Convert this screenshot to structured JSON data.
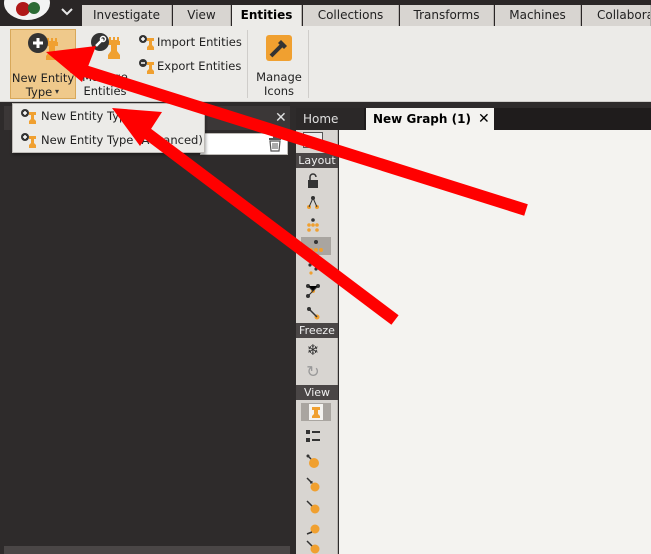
{
  "menubar": {
    "tabs": [
      {
        "label": "Investigate"
      },
      {
        "label": "View"
      },
      {
        "label": "Entities"
      },
      {
        "label": "Collections"
      },
      {
        "label": "Transforms"
      },
      {
        "label": "Machines"
      },
      {
        "label": "Collabora"
      }
    ],
    "active_tab": "Entities"
  },
  "ribbon": {
    "new_entity_type": {
      "line1": "New Entity",
      "line2": "Type"
    },
    "manage_entities": {
      "line1": "Manage",
      "line2": "Entities"
    },
    "import_entities": "Import Entities",
    "export_entities": "Export Entities",
    "manage_icons": {
      "line1": "Manage",
      "line2": "Icons"
    }
  },
  "dropdown": {
    "items": [
      {
        "label": "New Entity Type"
      },
      {
        "label": "New Entity Type (Advanced)"
      }
    ]
  },
  "graph_tabs": {
    "home": "Home",
    "graph": "New Graph (1)"
  },
  "toolbar": {
    "layout_label": "Layout",
    "freeze_label": "Freeze",
    "view_label": "View"
  },
  "colors": {
    "accent_orange": "#f0a030",
    "annotation_arrow": "#ff0000",
    "dark_panel": "#2e2b2b"
  }
}
